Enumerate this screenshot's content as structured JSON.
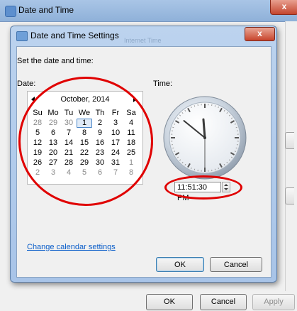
{
  "background_window": {
    "title": "Date and Time",
    "close_glyph": "x",
    "buttons": {
      "ok": "OK",
      "cancel": "Cancel",
      "apply": "Apply"
    }
  },
  "dialog": {
    "title": "Date and Time Settings",
    "close_glyph": "x",
    "ghost_text": "Internet Time",
    "instruction": "Set the date and time:",
    "date_label": "Date:",
    "time_label": "Time:",
    "change_calendar_link": "Change calendar settings",
    "ok_label": "OK",
    "cancel_label": "Cancel"
  },
  "calendar": {
    "month_year": "October, 2014",
    "weekdays": [
      "Su",
      "Mo",
      "Tu",
      "We",
      "Th",
      "Fr",
      "Sa"
    ],
    "selected_day": "1",
    "days": [
      {
        "d": "28",
        "other": true
      },
      {
        "d": "29",
        "other": true
      },
      {
        "d": "30",
        "other": true
      },
      {
        "d": "1",
        "other": false
      },
      {
        "d": "2",
        "other": false
      },
      {
        "d": "3",
        "other": false
      },
      {
        "d": "4",
        "other": false
      },
      {
        "d": "5",
        "other": false
      },
      {
        "d": "6",
        "other": false
      },
      {
        "d": "7",
        "other": false
      },
      {
        "d": "8",
        "other": false
      },
      {
        "d": "9",
        "other": false
      },
      {
        "d": "10",
        "other": false
      },
      {
        "d": "11",
        "other": false
      },
      {
        "d": "12",
        "other": false
      },
      {
        "d": "13",
        "other": false
      },
      {
        "d": "14",
        "other": false
      },
      {
        "d": "15",
        "other": false
      },
      {
        "d": "16",
        "other": false
      },
      {
        "d": "17",
        "other": false
      },
      {
        "d": "18",
        "other": false
      },
      {
        "d": "19",
        "other": false
      },
      {
        "d": "20",
        "other": false
      },
      {
        "d": "21",
        "other": false
      },
      {
        "d": "22",
        "other": false
      },
      {
        "d": "23",
        "other": false
      },
      {
        "d": "24",
        "other": false
      },
      {
        "d": "25",
        "other": false
      },
      {
        "d": "26",
        "other": false
      },
      {
        "d": "27",
        "other": false
      },
      {
        "d": "28",
        "other": false
      },
      {
        "d": "29",
        "other": false
      },
      {
        "d": "30",
        "other": false
      },
      {
        "d": "31",
        "other": false
      },
      {
        "d": "1",
        "other": true
      },
      {
        "d": "2",
        "other": true
      },
      {
        "d": "3",
        "other": true
      },
      {
        "d": "4",
        "other": true
      },
      {
        "d": "5",
        "other": true
      },
      {
        "d": "6",
        "other": true
      },
      {
        "d": "7",
        "other": true
      },
      {
        "d": "8",
        "other": true
      }
    ]
  },
  "clock": {
    "time_value": "11:51:30 PM",
    "hour": 11,
    "minute": 51,
    "second": 30
  },
  "colors": {
    "annotation_red": "#e00000",
    "link_blue": "#0b5ec9",
    "selection_blue": "#4a86c8"
  }
}
